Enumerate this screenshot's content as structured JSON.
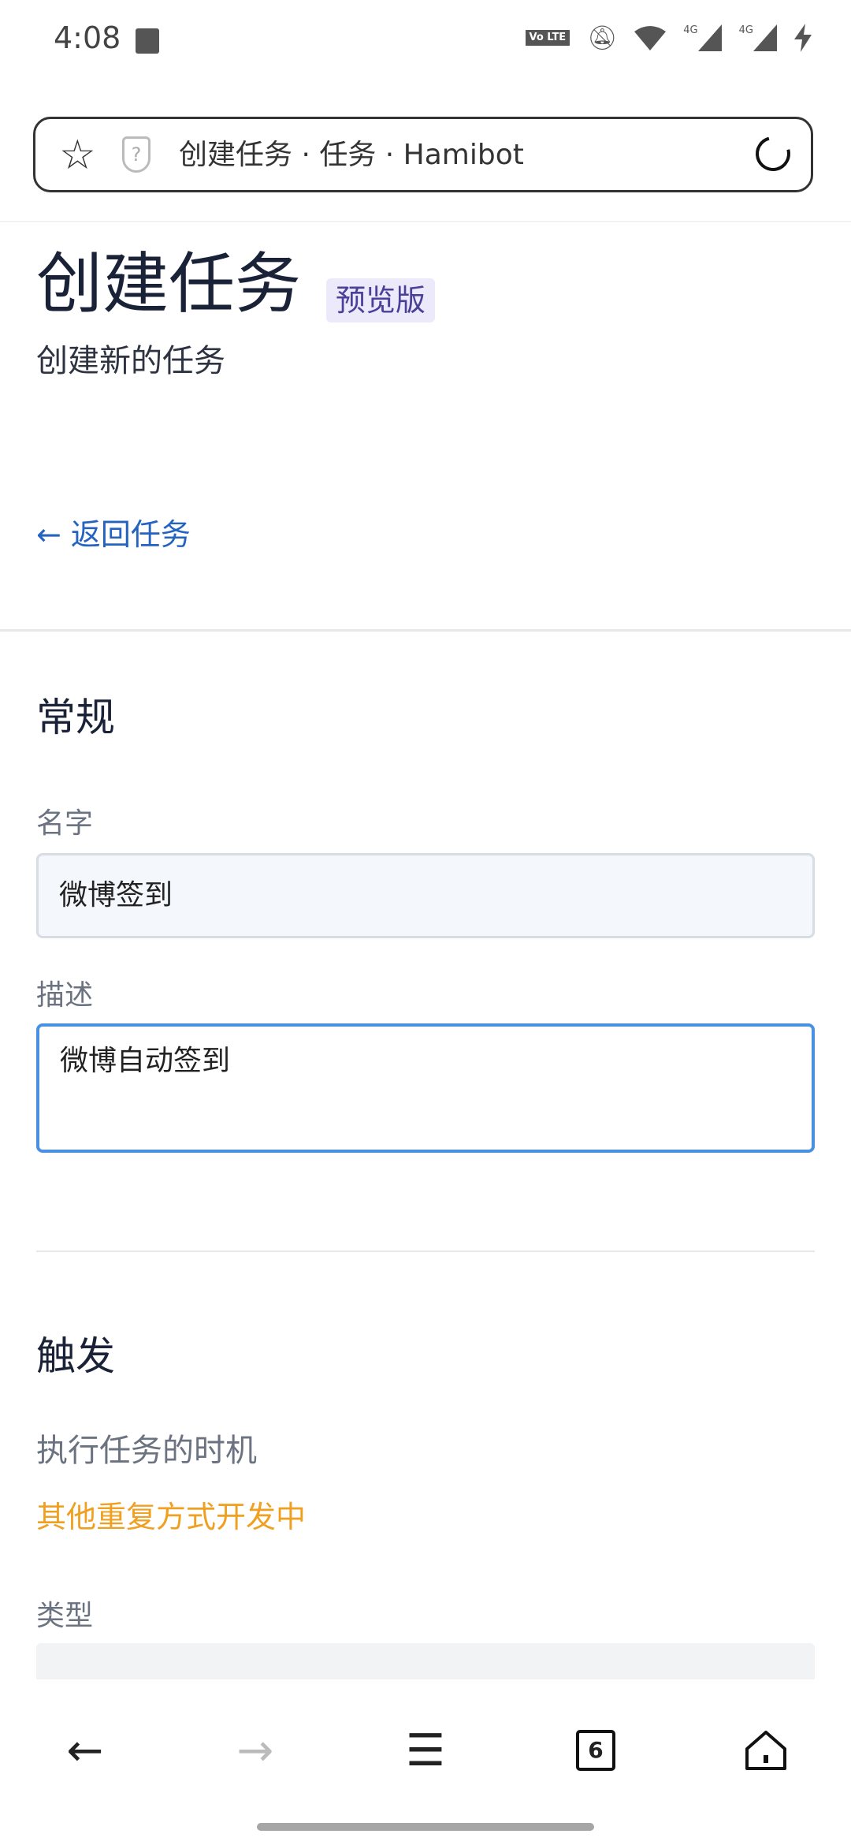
{
  "status_bar": {
    "time": "4:08",
    "icons": [
      "image-icon",
      "volte-icon",
      "bell-off-icon",
      "wifi-icon",
      "signal-4g-icon",
      "signal-4g-icon",
      "charging-icon"
    ],
    "volte_label": "Vo LTE",
    "net1": "4G",
    "net2": "4G"
  },
  "browser": {
    "url_title": "创建任务 · 任务 · Hamibot",
    "shield_glyph": "?"
  },
  "header": {
    "title": "创建任务",
    "badge": "预览版",
    "subtitle": "创建新的任务",
    "back_link": "← 返回任务"
  },
  "general": {
    "heading": "常规",
    "name_label": "名字",
    "name_value": "微博签到",
    "desc_label": "描述",
    "desc_value": "微博自动签到"
  },
  "trigger": {
    "heading": "触发",
    "hint": "执行任务的时机",
    "warning": "其他重复方式开发中",
    "type_label": "类型"
  },
  "bottom_nav": {
    "tab_count": "6"
  },
  "colors": {
    "link": "#2563c0",
    "warning": "#f0a020",
    "badge_bg": "#ece9fb",
    "focus": "#4a90e2"
  }
}
